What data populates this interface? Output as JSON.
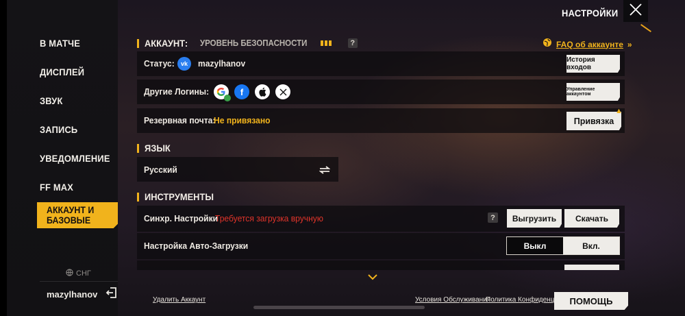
{
  "header": {
    "title": "НАСТРОЙКИ"
  },
  "sidebar": {
    "items": [
      {
        "label": "В МАТЧЕ"
      },
      {
        "label": "ДИСПЛЕЙ"
      },
      {
        "label": "ЗВУК"
      },
      {
        "label": "ЗАПИСЬ"
      },
      {
        "label": "УВЕДОМЛЕНИЕ"
      },
      {
        "label": "FF MAX"
      }
    ],
    "active": {
      "line1": "АККАУНТ И",
      "line2": "БАЗОВЫЕ"
    },
    "region": "СНГ",
    "username": "mazylhanov"
  },
  "account": {
    "title": "АККАУНТ:",
    "security_label": "УРОВЕНЬ БЕЗОПАСНОСТИ",
    "security_level": 3,
    "faq_label": "FAQ об аккаунте",
    "status_label": "Статус:",
    "status_user": "mazylhanov",
    "login_history_button": "История входов",
    "other_logins_label": "Другие Логины:",
    "manage_account_button": "Управление аккаунтом",
    "backup_email_label": "Резервная почта:",
    "backup_email_value": "Не привязано",
    "bind_button": "Привязка"
  },
  "language": {
    "title": "ЯЗЫК",
    "value": "Русский"
  },
  "tools": {
    "title": "ИНСТРУМЕНТЫ",
    "sync_label": "Синхр. Настройки",
    "sync_status": "Требуется загрузка вручную",
    "upload_button": "Выгрузить",
    "download_button": "Скачать",
    "autoload_label": "Настройка Авто-Загрузки",
    "off_label": "Выкл",
    "on_label": "Вкл.",
    "autoload_state": "off"
  },
  "footer": {
    "delete_account": "Удалить Аккаунт",
    "terms": "Условия Обслуживания",
    "privacy": "Политика Конфиденц.",
    "help_button": "ПОМОЩЬ"
  },
  "colors": {
    "accent": "#f1b31c",
    "warning": "#e0342a",
    "vk": "#2a7ef0"
  }
}
